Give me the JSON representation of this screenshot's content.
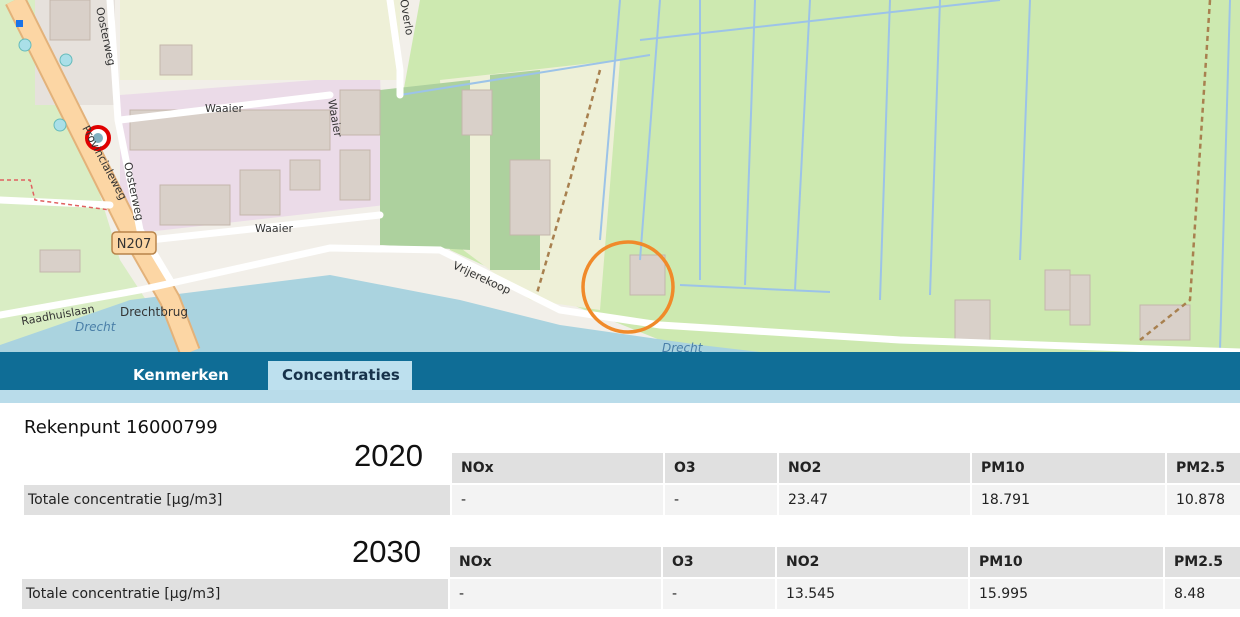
{
  "map": {
    "labels": {
      "oosterweg_1": "Oosterweg",
      "oosterweg_2": "Oosterweg",
      "overlop": "Overlo",
      "waaier_1": "Waaier",
      "waaier_2": "Waaier",
      "waaier_3": "Waaier",
      "provincialeweg": "Provincialeweg",
      "n207": "N207",
      "vrijerekoop": "Vrijerekoop",
      "raadhuislaan": "Raadhuislaan",
      "drechtbrug": "Drechtbrug",
      "drecht_1": "Drecht",
      "drecht_2": "Drecht"
    },
    "colors": {
      "meadow": "#cde9b0",
      "water": "#aad3df",
      "road_main": "#fcd6a4",
      "industrial": "#ebdbe8",
      "building": "#d9d0c9",
      "marker_ring": "#e00000",
      "highlight_circle": "#f08a2a"
    }
  },
  "tabs": [
    {
      "label": "Kenmerken",
      "active": false
    },
    {
      "label": "Concentraties",
      "active": true
    }
  ],
  "panel": {
    "title": "Rekenpunt 16000799",
    "row_label": "Totale concentratie [µg/m3]",
    "tables": [
      {
        "year": "2020",
        "columns": [
          "NOx",
          "O3",
          "NO2",
          "PM10",
          "PM2.5"
        ],
        "values": [
          "-",
          "-",
          "23.47",
          "18.791",
          "10.878"
        ]
      },
      {
        "year": "2030",
        "columns": [
          "NOx",
          "O3",
          "NO2",
          "PM10",
          "PM2.5"
        ],
        "values": [
          "-",
          "-",
          "13.545",
          "15.995",
          "8.48"
        ]
      }
    ]
  }
}
